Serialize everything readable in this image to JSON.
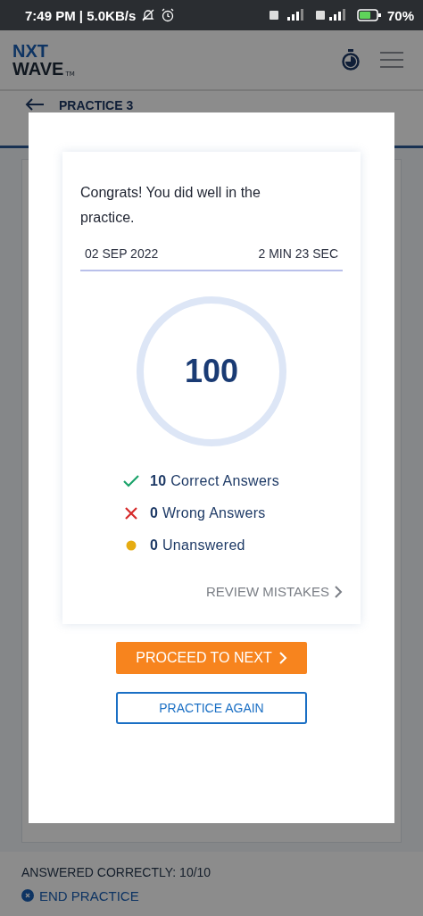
{
  "status_bar": {
    "time": "7:49 PM | 5.0KB/s",
    "battery": "70%"
  },
  "header": {
    "logo_top": "NXT",
    "logo_bottom": "WAVE",
    "logo_mark": "TM"
  },
  "practice": {
    "title": "PRACTICE 3"
  },
  "footer": {
    "answered": "ANSWERED CORRECTLY: 10/10",
    "end_button": "END PRACTICE"
  },
  "dialog": {
    "message": "Congrats! You did well in the practice.",
    "date": "02 SEP 2022",
    "duration": "2 MIN 23 SEC",
    "score": "100",
    "results": [
      {
        "kind": "correct",
        "text": "**10** Correct Answers"
      },
      {
        "kind": "wrong",
        "text": "**0** Wrong Answers"
      },
      {
        "kind": "unanswered",
        "text": "**0** Unanswered"
      }
    ],
    "review_link": "REVIEW MISTAKES",
    "primary_button": "PROCEED TO NEXT",
    "secondary_button": "PRACTICE AGAIN"
  }
}
